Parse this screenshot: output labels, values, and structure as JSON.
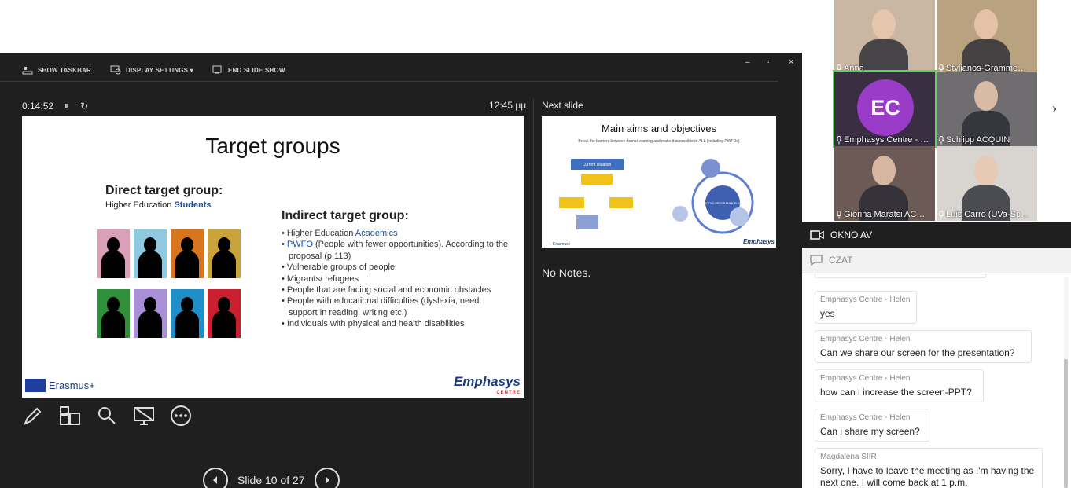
{
  "toolbar": {
    "show_taskbar": "SHOW TASKBAR",
    "display_settings": "DISPLAY SETTINGS ▾",
    "end_slide_show": "END SLIDE SHOW"
  },
  "timer": {
    "elapsed": "0:14:52",
    "pause": "⏸",
    "reset": "↻"
  },
  "clock": "12:45 μμ",
  "next_slide_label": "Next slide",
  "current_slide": {
    "title": "Target groups",
    "direct_heading": "Direct target group:",
    "direct_sub_prefix": "Higher Education",
    "direct_sub_highlight": "Students",
    "indirect_heading": "Indirect target group:",
    "bullets": [
      {
        "pre": "Higher Education ",
        "hl": "Academics",
        "post": ""
      },
      {
        "pre": "",
        "hl": "PWFO",
        "post": " (People with fewer opportunities). According to the proposal (p.113)"
      },
      {
        "pre": "Vulnerable groups of people",
        "hl": "",
        "post": ""
      },
      {
        "pre": "Migrants/ refugees",
        "hl": "",
        "post": ""
      },
      {
        "pre": "People that are facing social and economic obstacles",
        "hl": "",
        "post": ""
      },
      {
        "pre": "People with educational difficulties (dyslexia, need support in reading, writing etc.)",
        "hl": "",
        "post": ""
      },
      {
        "pre": "Individuals with physical and health disabilities",
        "hl": "",
        "post": ""
      }
    ],
    "tile_colors": [
      "#d9a0b8",
      "#8fc9e0",
      "#d9741f",
      "#c9a23a",
      "#2f8f3a",
      "#a88fd6",
      "#1f8fc9",
      "#c91f2f"
    ],
    "erasmus": "Erasmus+",
    "emphasys": "Emphasys",
    "emphasys_sub": "CENTRE"
  },
  "next_slide": {
    "title": "Main aims and objectives",
    "subtitle": "Break the barriers between formal learning and make it accessible to ALL (including PWFOs)",
    "current_situation": "Current situation",
    "center_label": "INTERACTIVE PROGRAMME PLATFORM",
    "erasmus": "Erasmus+",
    "emphasys": "Emphasys"
  },
  "notes": "No Notes.",
  "slide_nav": {
    "label": "Slide 10 of 27"
  },
  "participants": [
    {
      "name": "Anna",
      "bg": "#c9b7a3"
    },
    {
      "name": "Stylianos-Gramme…",
      "bg": "#b9a27f"
    },
    {
      "name": "Emphasys Centre - …",
      "bg": "#3a2e43",
      "initials": "EC"
    },
    {
      "name": "Schlipp ACQUIN",
      "bg": "#6f6d6f"
    },
    {
      "name": "Giorina Maratsi AC…",
      "bg": "#6b5a55"
    },
    {
      "name": "Luis Carro (UVa-Sp…",
      "bg": "#d8d4cf"
    }
  ],
  "okno_av": "OKNO AV",
  "czat": "CZAT",
  "chat_messages": [
    {
      "who": "Emphasys Centre - Helen",
      "text": "yes"
    },
    {
      "who": "Emphasys Centre - Helen",
      "text": "Can we share our screen for the presentation?"
    },
    {
      "who": "Emphasys Centre - Helen",
      "text": "how can i increase the screen-PPT?"
    },
    {
      "who": "Emphasys Centre - Helen",
      "text": "Can i share my screen?"
    },
    {
      "who": "Magdalena SIIR",
      "text": "Sorry, I have to leave the meeting as I'm having the next one. I will come back at 1 p.m."
    }
  ]
}
